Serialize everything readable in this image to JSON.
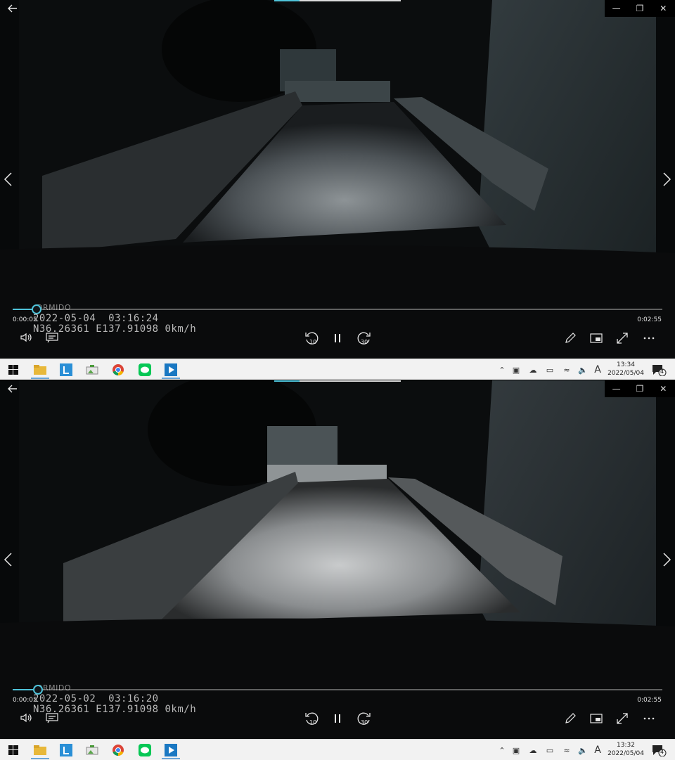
{
  "players": [
    {
      "brand": "DRMIDO",
      "elapsed": "0:00:05",
      "duration": "0:02:55",
      "stamp_line1": "2022-05-04  03:16:24",
      "stamp_line2": "N36.26361 E137.91098 0km/h",
      "progress_fraction": 0.036,
      "skip_back": "10",
      "skip_forward": "30",
      "taskbar_time": "13:34",
      "taskbar_date": "2022/05/04",
      "notif_count": "4",
      "ime": "A",
      "road_brightness": 0.55
    },
    {
      "brand": "DRMIDO",
      "elapsed": "0:00:05",
      "duration": "0:02:55",
      "stamp_line1": "2022-05-02  03:16:20",
      "stamp_line2": "N36.26361 E137.91098 0km/h",
      "progress_fraction": 0.038,
      "skip_back": "10",
      "skip_forward": "30",
      "taskbar_time": "13:32",
      "taskbar_date": "2022/05/04",
      "notif_count": "4",
      "ime": "A",
      "road_brightness": 0.85
    }
  ],
  "icons": {
    "back": "arrow-left-icon",
    "prev": "chevron-left-icon",
    "next": "chevron-right-icon",
    "volume": "volume-icon",
    "subtitles": "subtitles-icon",
    "rewind": "rewind-10-icon",
    "pause": "pause-icon",
    "forward": "forward-30-icon",
    "edit": "pencil-icon",
    "miniplayer": "miniplayer-icon",
    "fullscreen": "fullscreen-icon",
    "more": "more-icon"
  },
  "colors": {
    "accent": "#4fc3d9",
    "taskbar": "#f2f2f2"
  }
}
